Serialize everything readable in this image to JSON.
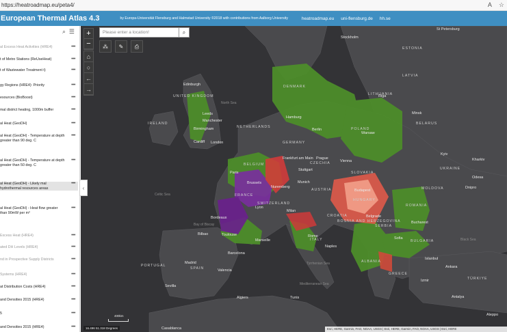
{
  "browser": {
    "url": "https://heatroadmap.eu/peta4/",
    "icons": [
      "A",
      "☆"
    ]
  },
  "header": {
    "title": "European Thermal Atlas 4.3",
    "byline": "by Europa-Universität Flensburg and Halmstad University ©2018 with contributions from Aalborg University",
    "links": [
      "heatroadmap.eu",
      "uni-flensburg.de",
      "hh.se"
    ]
  },
  "sidebar": {
    "layers": [
      {
        "label": "al Excess Heat Activities (HRE4)",
        "dim": true
      },
      {
        "label": "t of Metro Stations (ReUseHeat)",
        "dim": false
      },
      {
        "label": "t of Wastewater Treatment t)",
        "dim": false
      },
      {
        "label": "gy Regions (HRE4): Priority",
        "dim": false
      },
      {
        "label": "esources (BioBoost)",
        "dim": false
      },
      {
        "label": "mal district heating, 1000m buffer",
        "dim": false
      },
      {
        "label": "al Heat (GeoDH)",
        "dim": false
      },
      {
        "label": "al Heat (GeoDH) - Temperature at depth greater than 90 deg. C",
        "dim": false
      },
      {
        "label": "al Heat (GeoDH) - Temperature at depth greater than 50 deg. C",
        "dim": false
      },
      {
        "label": "al Heat (GeoDH) - Likely mal hydrothermal resources areas",
        "dim": false
      },
      {
        "label": "al Heat (GeoDH) - Heat flow greater than 90mW per m²",
        "dim": false
      },
      {
        "label": "Excess Heat (HRE4)",
        "dim": true
      },
      {
        "label": "ated DH Levels (HRE4)",
        "dim": true
      },
      {
        "label": "nd in Prospective Supply Districts",
        "dim": true
      },
      {
        "label": "Systems (HRE4)",
        "dim": true
      },
      {
        "label": "at Distribution Costs (HRE4)",
        "dim": false
      },
      {
        "label": "and Densities 2015 (HRE4)",
        "dim": false
      },
      {
        "label": "5",
        "dim": false
      },
      {
        "label": "and Densities 2015 (HRE4)",
        "dim": false
      }
    ]
  },
  "map": {
    "search_placeholder": "Please enter a location!",
    "coordinates": "16.496 51.318 Degrees",
    "scale_label": "400km",
    "attribution": "Esri, HERE, Garmin, FAO, NOAA, USGS | Esri, HERE, Garmin, FAO, NOAA, USGS | Esri, HERE",
    "countries": [
      "ESTONIA",
      "LATVIA",
      "LITHUANIA",
      "BELARUS",
      "UKRAINE",
      "MOLDOVA",
      "ROMANIA",
      "UNITED KINGDOM",
      "IRELAND",
      "NETHERLANDS",
      "BELGIUM",
      "GERMANY",
      "POLAND",
      "CZECHIA",
      "SLOVAKIA",
      "HUNGARY",
      "AUSTRIA",
      "SWITZERLAND",
      "FRANCE",
      "CROATIA",
      "BOSNIA AND HERZEGOVINA",
      "SERBIA",
      "BULGARIA",
      "ITALY",
      "ALBANIA",
      "GREECE",
      "TÜRKIYE",
      "SPAIN",
      "PORTUGAL",
      "DENMARK"
    ],
    "cities": [
      "St Petersburg",
      "Stockholm",
      "Riga",
      "Minsk",
      "Kyiv",
      "Kharkiv",
      "Warsaw",
      "Berlin",
      "Hamburg",
      "Prague",
      "Vienna",
      "Budapest",
      "Munich",
      "Frankfurt am Main",
      "Paris",
      "London",
      "Birmingham",
      "Cardiff",
      "Leeds",
      "Manchester",
      "Edinburgh",
      "Bordeaux",
      "Toulouse",
      "Lyon",
      "Milan",
      "Rome",
      "Naples",
      "Barcelona",
      "Madrid",
      "Valencia",
      "Sevilla",
      "Algiers",
      "Tunis",
      "Bucharest",
      "Sofia",
      "Istanbul",
      "Ankara",
      "Izmir",
      "Antalya",
      "Casablanca",
      "Belgrade",
      "Stuttgart",
      "Nuremberg",
      "Brussels",
      "Bilbao",
      "Marseille",
      "Dnipro",
      "Odesa",
      "Aleppo"
    ],
    "seas": [
      "Celtic Sea",
      "Bay of Biscay",
      "Black Sea",
      "Mediterranean Sea",
      "Tyrrhenian Sea",
      "North Sea"
    ]
  }
}
